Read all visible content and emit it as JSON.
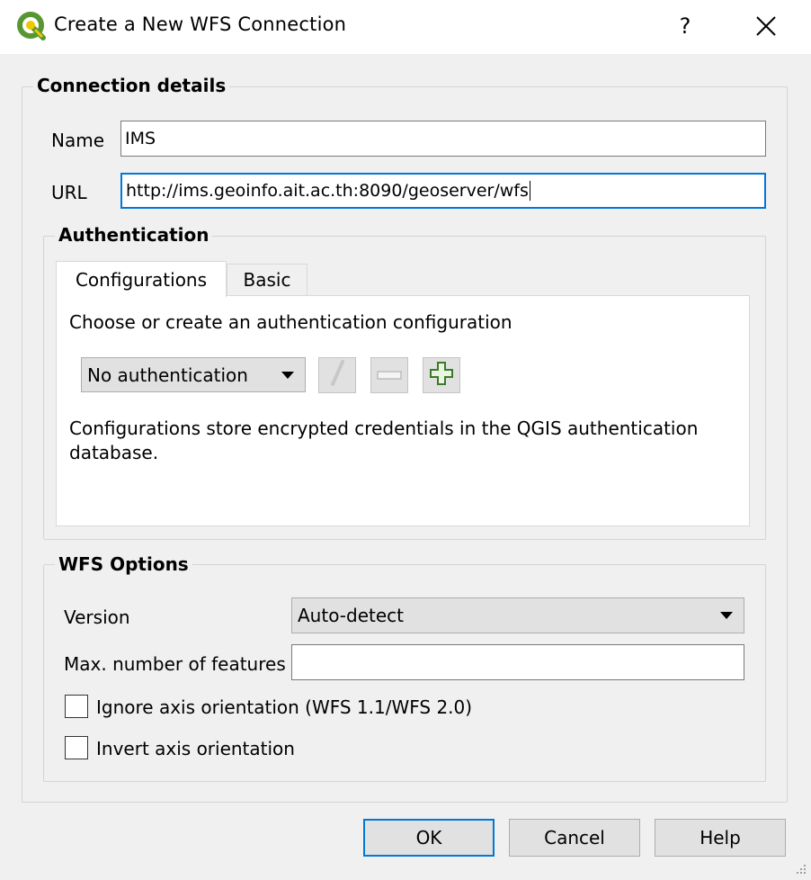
{
  "window": {
    "title": "Create a New WFS Connection",
    "help_glyph": "?",
    "close_glyph": "✕"
  },
  "connection": {
    "group_title": "Connection details",
    "name_label": "Name",
    "name_value": "IMS",
    "url_label": "URL",
    "url_value": "http://ims.geoinfo.ait.ac.th:8090/geoserver/wfs"
  },
  "auth": {
    "group_title": "Authentication",
    "tabs": [
      "Configurations",
      "Basic"
    ],
    "choose_text": "Choose or create an authentication configuration",
    "combo_value": "No authentication",
    "info_line1": "Configurations store encrypted credentials in the QGIS authentication",
    "info_line2": "database."
  },
  "wfs": {
    "group_title": "WFS Options",
    "version_label": "Version",
    "version_value": "Auto-detect",
    "max_label": "Max. number of features",
    "max_value": "",
    "ignore_axis_label": "Ignore axis orientation (WFS 1.1/WFS 2.0)",
    "invert_axis_label": "Invert axis orientation"
  },
  "buttons": {
    "ok": "OK",
    "cancel": "Cancel",
    "help": "Help"
  },
  "colors": {
    "accent": "#0078d7",
    "qgis_green": "#589632",
    "qgis_yellow": "#eec900"
  }
}
